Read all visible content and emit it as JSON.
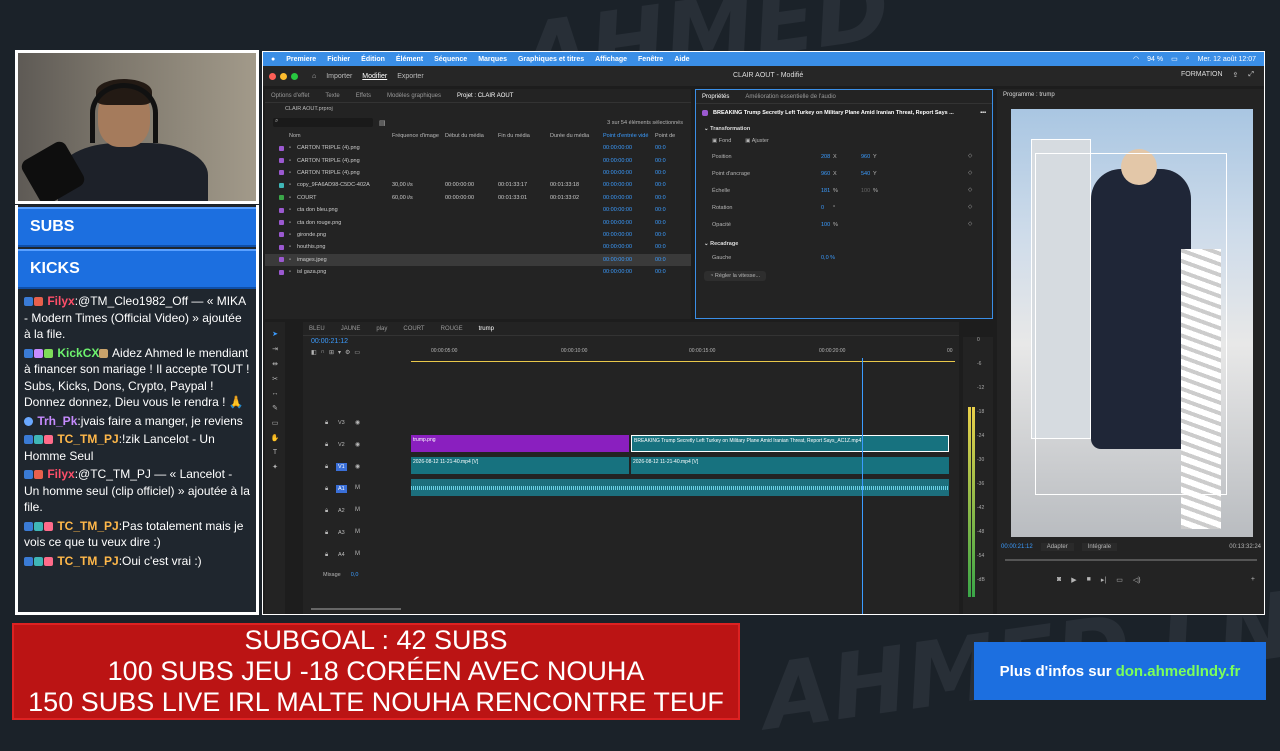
{
  "chat": {
    "banners": [
      "SUBS",
      "KICKS"
    ],
    "messages": [
      {
        "user": "Filyx",
        "user_color": "#ff4f6a",
        "text": ":@TM_Cleo1982_Off — « MIKA - Modern Times (Official Video) » ajoutée à la file."
      },
      {
        "user": "KickCX",
        "user_color": "#6ef26e",
        "text": " Aidez Ahmed le mendiant à financer son mariage ! Il accepte TOUT ! Subs, Kicks, Dons, Crypto, Paypal ! Donnez donnez, Dieu vous le rendra ! 🙏"
      },
      {
        "user": "Trh_Pk",
        "user_color": "#c78bff",
        "text": ":jvais faire a manger, je reviens"
      },
      {
        "user": "TC_TM_PJ",
        "user_color": "#ffb84a",
        "text": ":!zik Lancelot - Un Homme Seul"
      },
      {
        "user": "Filyx",
        "user_color": "#ff4f6a",
        "text": ":@TC_TM_PJ — « Lancelot - Un homme seul (clip officiel) » ajoutée à la file."
      },
      {
        "user": "TC_TM_PJ",
        "user_color": "#ffb84a",
        "text": ":Pas totalement mais je vois ce que tu veux dire :)"
      },
      {
        "user": "TC_TM_PJ",
        "user_color": "#ffb84a",
        "text": ":Oui c'est vrai :)"
      }
    ]
  },
  "menubar": {
    "items": [
      "Premiere",
      "Fichier",
      "Édition",
      "Élément",
      "Séquence",
      "Marques",
      "Graphiques et titres",
      "Affichage",
      "Fenêtre",
      "Aide"
    ],
    "battery": "94 %",
    "datetime": "Mer. 12 août  12:07"
  },
  "titlebar": {
    "tabs": [
      "Importer",
      "Modifier",
      "Exporter"
    ],
    "title": "CLAIR AOUT - Modifié",
    "workspace": "FORMATION"
  },
  "project": {
    "tabs": [
      "Options d'effet",
      "Texte",
      "Effets",
      "Modèles graphiques",
      "Projet : CLAIR AOUT"
    ],
    "file": "CLAIR AOUT.prproj",
    "count": "3 sur 54 éléments sélectionnés",
    "columns": [
      "Nom",
      "Fréquence d'image",
      "Début du média",
      "Fin du média",
      "Durée du média",
      "Point d'entrée vidé",
      "Point de"
    ],
    "rows": [
      {
        "name": "CARTON TRIPLE (4).png",
        "color": "#9b59d0",
        "fps": "",
        "start": "",
        "end": "",
        "dur": "",
        "in": "00:00:00:00",
        "pt": "00:0"
      },
      {
        "name": "CARTON TRIPLE (4).png",
        "color": "#9b59d0",
        "fps": "",
        "start": "",
        "end": "",
        "dur": "",
        "in": "00:00:00:00",
        "pt": "00:0"
      },
      {
        "name": "CARTON TRIPLE (4).png",
        "color": "#9b59d0",
        "fps": "",
        "start": "",
        "end": "",
        "dur": "",
        "in": "00:00:00:00",
        "pt": "00:0"
      },
      {
        "name": "copy_9FA6AD98-C5DC-402A",
        "color": "#3fb6b6",
        "fps": "30,00 i/s",
        "start": "00:00:00:00",
        "end": "00:01:33:17",
        "dur": "00:01:33:18",
        "in": "00:00:00:00",
        "pt": "00:0"
      },
      {
        "name": "COURT",
        "color": "#3aa648",
        "fps": "60,00 i/s",
        "start": "00:00:00:00",
        "end": "00:01:33:01",
        "dur": "00:01:33:02",
        "in": "00:00:00:00",
        "pt": "00:0"
      },
      {
        "name": "cta don bleu.png",
        "color": "#9b59d0",
        "fps": "",
        "start": "",
        "end": "",
        "dur": "",
        "in": "00:00:00:00",
        "pt": "00:0"
      },
      {
        "name": "cta don rouge.png",
        "color": "#9b59d0",
        "fps": "",
        "start": "",
        "end": "",
        "dur": "",
        "in": "00:00:00:00",
        "pt": "00:0"
      },
      {
        "name": "gironde.png",
        "color": "#9b59d0",
        "fps": "",
        "start": "",
        "end": "",
        "dur": "",
        "in": "00:00:00:00",
        "pt": "00:0"
      },
      {
        "name": "houthis.png",
        "color": "#9b59d0",
        "fps": "",
        "start": "",
        "end": "",
        "dur": "",
        "in": "00:00:00:00",
        "pt": "00:0"
      },
      {
        "name": "images.jpeg",
        "color": "#9b59d0",
        "fps": "",
        "start": "",
        "end": "",
        "dur": "",
        "in": "00:00:00:00",
        "pt": "00:0"
      },
      {
        "name": "isl gaza.png",
        "color": "#9b59d0",
        "fps": "",
        "start": "",
        "end": "",
        "dur": "",
        "in": "00:00:00:00",
        "pt": "00:0"
      }
    ]
  },
  "props": {
    "tabs": [
      "Propriétés",
      "Amélioration essentielle de l'audio"
    ],
    "clip_title": "BREAKING Trump Secretly Left Turkey on Military Plane Amid Iranian Threat, Report Says ...",
    "section1": "Transformation",
    "fond": "Fond",
    "ajuster": "Ajuster",
    "rows": [
      {
        "label": "Position",
        "v1": "208",
        "u1": "X",
        "v2": "960",
        "u2": "Y"
      },
      {
        "label": "Point d'ancrage",
        "v1": "960",
        "u1": "X",
        "v2": "540",
        "u2": "Y"
      },
      {
        "label": "Échelle",
        "v1": "181",
        "u1": "%",
        "v2": "100",
        "u2": "%"
      },
      {
        "label": "Rotation",
        "v1": "0",
        "u1": "°",
        "v2": "",
        "u2": ""
      },
      {
        "label": "Opacité",
        "v1": "100",
        "u1": "%",
        "v2": "",
        "u2": ""
      }
    ],
    "section2": "Recadrage",
    "gauche_label": "Gauche",
    "gauche_val": "0,0 %",
    "speed": "Régler la vitesse..."
  },
  "timeline": {
    "tabs": [
      "BLEU",
      "JAUNE",
      "play",
      "COURT",
      "ROUGE",
      "trump"
    ],
    "timecode": "00:00:21:12",
    "ruler": [
      "00:00:05:00",
      "00:00:10:00",
      "00:00:15:00",
      "00:00:20:00",
      "00"
    ],
    "tracks": [
      "V3",
      "V2",
      "V1",
      "A1",
      "A2",
      "A3",
      "A4"
    ],
    "mix_label": "Mixage",
    "mix_value": "0,0",
    "clips": {
      "v2a": "trump.png",
      "v2b": "BREAKING Trump Secretly Left Turkey on Military Plane Amid Iranian Threat, Report Says_AC1Z.mp4",
      "v1a": "2026-08-12 11-21-40.mp4 [V]",
      "v1b": "2026-08-12 11-21-40.mp4 [V]"
    },
    "meter": [
      "0",
      "-6",
      "-12",
      "-18",
      "-24",
      "-30",
      "-36",
      "-42",
      "-48",
      "-54",
      "-dB"
    ]
  },
  "program": {
    "title": "Programme : trump",
    "timecode": "00:00:21:12",
    "fit": "Adapter",
    "quality": "Intégrale",
    "duration": "00:13:32:24"
  },
  "overlay": {
    "goal_lines": [
      "SUBGOAL : 42 SUBS",
      "100 SUBS JEU -18 CORÉEN AVEC NOUHA",
      "150 SUBS LIVE IRL MALTE NOUHA RENCONTRE TEUF"
    ],
    "info_prefix": "Plus d'infos sur",
    "info_link": "don.ahmedlndy.fr"
  }
}
